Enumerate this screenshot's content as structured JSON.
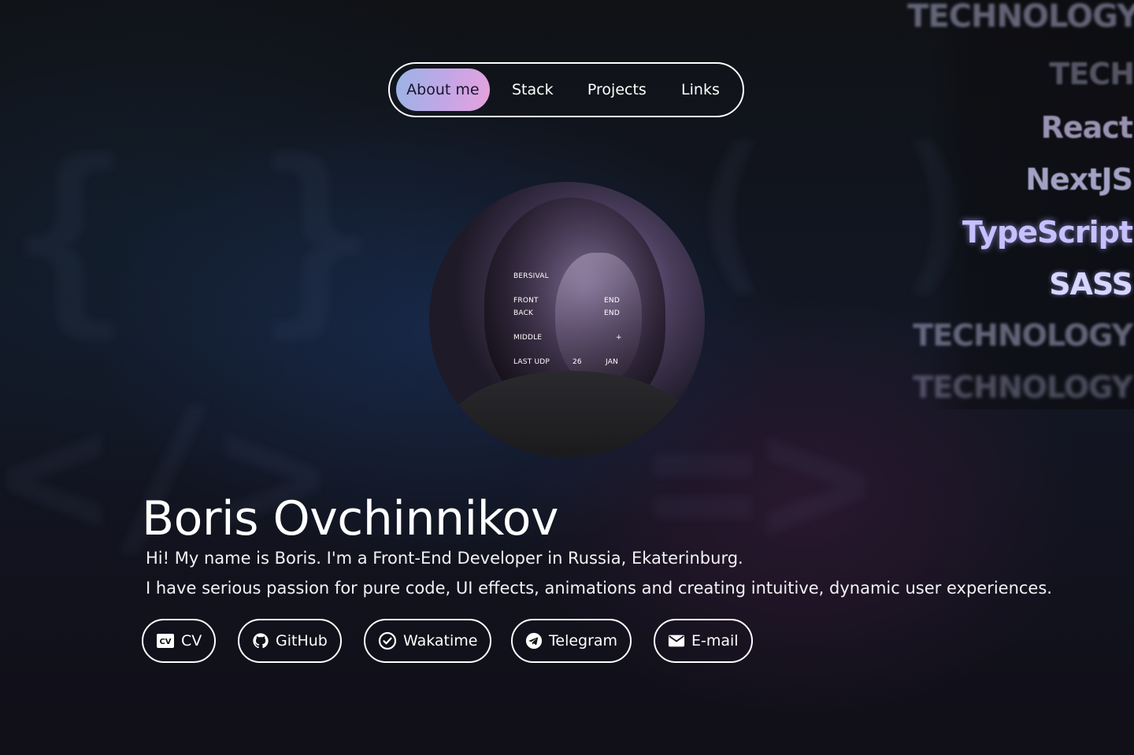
{
  "nav": {
    "items": [
      {
        "label": "About me",
        "active": true
      },
      {
        "label": "Stack",
        "active": false
      },
      {
        "label": "Projects",
        "active": false
      },
      {
        "label": "Links",
        "active": false
      }
    ],
    "active_gradient": [
      "#9ab4e6",
      "#c4a6e6",
      "#e6a2dc"
    ]
  },
  "tech_words": [
    "TECHNOLOGY",
    "TECH",
    "React",
    "NextJS",
    "TypeScript",
    "SASS",
    "TECHNOLOGY",
    "TECHNOLOGY"
  ],
  "avatar": {
    "overlay": {
      "handle": "BERSIVAL",
      "front": "FRONT",
      "back": "BACK",
      "end1": "END",
      "end2": "END",
      "middle": "MIDDLE",
      "plus": "+",
      "last_udp": "LAST UDP",
      "day": "26",
      "month": "JAN"
    }
  },
  "hero": {
    "name": "Boris Ovchinnikov",
    "bio_line1": "Hi! My name is Boris. I'm a Front-End Developer in Russia, Ekaterinburg.",
    "bio_line2": "I have serious passion for pure code, UI effects, animations and creating intuitive, dynamic user experiences."
  },
  "links": [
    {
      "label": "CV",
      "icon": "cv-icon"
    },
    {
      "label": "GitHub",
      "icon": "github-icon"
    },
    {
      "label": "Wakatime",
      "icon": "wakatime-icon"
    },
    {
      "label": "Telegram",
      "icon": "telegram-icon"
    },
    {
      "label": "E-mail",
      "icon": "mail-icon"
    }
  ],
  "colors": {
    "background": "#0d0d11",
    "text": "#ffffff",
    "tech_glow": "#b7b2ff"
  }
}
